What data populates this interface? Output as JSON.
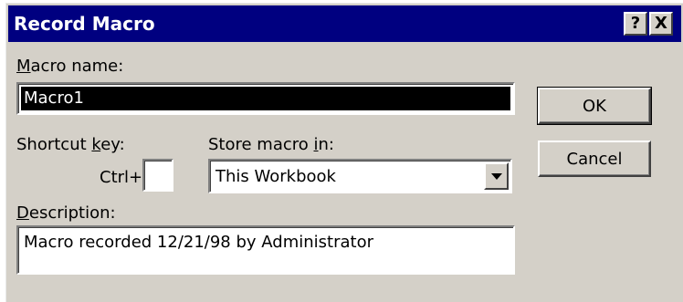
{
  "window": {
    "title": "Record Macro",
    "help_glyph": "?",
    "close_glyph": "X"
  },
  "macro_name": {
    "label": "Macro name:",
    "value": "Macro1"
  },
  "shortcut": {
    "label": "Shortcut key:",
    "prefix": "Ctrl+",
    "value": ""
  },
  "store": {
    "label": "Store macro in:",
    "value": "This Workbook"
  },
  "description": {
    "label": "Description:",
    "value": "Macro recorded 12/21/98 by Administrator"
  },
  "buttons": {
    "ok": "OK",
    "cancel": "Cancel"
  },
  "colors": {
    "titlebar": "#000080",
    "face": "#d4d0c8",
    "selection": "#000000"
  },
  "icons": [
    "help-icon",
    "close-icon",
    "dropdown-arrow-icon"
  ]
}
